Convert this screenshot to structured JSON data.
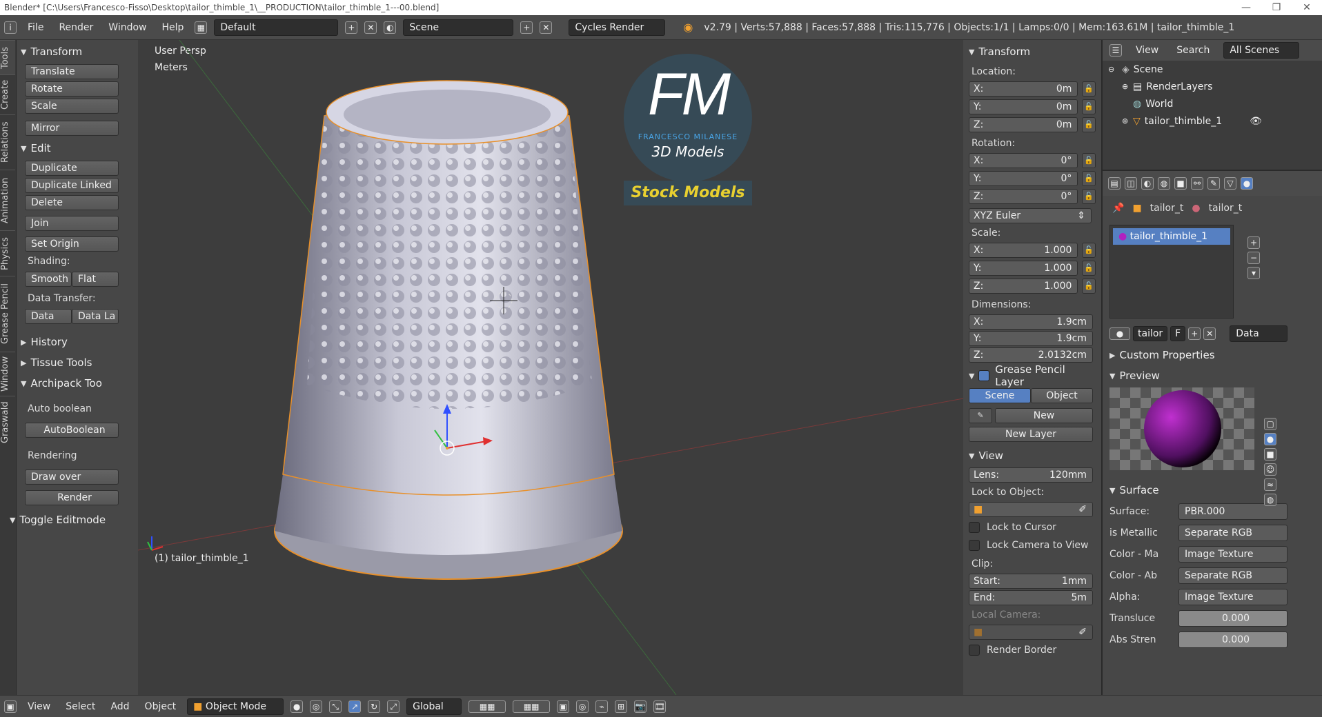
{
  "title_bar": {
    "text": "Blender* [C:\\Users\\Francesco-Fisso\\Desktop\\tailor_thimble_1\\__PRODUCTION\\tailor_thimble_1---00.blend]",
    "minimize": "—",
    "maximize": "❐",
    "close": "✕"
  },
  "info_bar": {
    "menus": [
      "File",
      "Render",
      "Window",
      "Help"
    ],
    "layout": "Default",
    "scene": "Scene",
    "engine": "Cycles Render",
    "stats": "v2.79 | Verts:57,888 | Faces:57,888 | Tris:115,776 | Objects:1/1 | Lamps:0/0 | Mem:163.61M | tailor_thimble_1"
  },
  "left_tabs": [
    "Tools",
    "Create",
    "Relations",
    "Animation",
    "Physics",
    "Grease Pencil",
    "Window",
    "Graswald"
  ],
  "tool_shelf": {
    "transform": {
      "title": "Transform",
      "buttons": [
        "Translate",
        "Rotate",
        "Scale",
        "Mirror"
      ]
    },
    "edit": {
      "title": "Edit",
      "buttons": [
        "Duplicate",
        "Duplicate Linked",
        "Delete",
        "Join"
      ],
      "set_origin": "Set Origin",
      "shading_label": "Shading:",
      "smooth": "Smooth",
      "flat": "Flat",
      "data_transfer_label": "Data Transfer:",
      "data": "Data",
      "data_la": "Data La"
    },
    "history": "History",
    "tissue": "Tissue Tools",
    "archipack": "Archipack Too",
    "auto_boolean_label": "Auto boolean",
    "auto_boolean_btn": "AutoBoolean",
    "rendering_label": "Rendering",
    "draw_over": "Draw over",
    "render_btn": "Render",
    "toggle_editmode": "Toggle Editmode"
  },
  "viewport": {
    "view_name": "User Persp",
    "units": "Meters",
    "object_label": "(1) tailor_thimble_1",
    "logo": {
      "letters": "FM",
      "brand": "FRANCESCO MILANESE",
      "line2": "3D Models",
      "banner": "Stock Models"
    }
  },
  "n_panel": {
    "transform_title": "Transform",
    "location_label": "Location:",
    "location": [
      {
        "axis": "X:",
        "value": "0m"
      },
      {
        "axis": "Y:",
        "value": "0m"
      },
      {
        "axis": "Z:",
        "value": "0m"
      }
    ],
    "rotation_label": "Rotation:",
    "rotation": [
      {
        "axis": "X:",
        "value": "0°"
      },
      {
        "axis": "Y:",
        "value": "0°"
      },
      {
        "axis": "Z:",
        "value": "0°"
      }
    ],
    "rotation_mode": "XYZ Euler",
    "scale_label": "Scale:",
    "scale": [
      {
        "axis": "X:",
        "value": "1.000"
      },
      {
        "axis": "Y:",
        "value": "1.000"
      },
      {
        "axis": "Z:",
        "value": "1.000"
      }
    ],
    "dimensions_label": "Dimensions:",
    "dimensions": [
      {
        "axis": "X:",
        "value": "1.9cm"
      },
      {
        "axis": "Y:",
        "value": "1.9cm"
      },
      {
        "axis": "Z:",
        "value": "2.0132cm"
      }
    ],
    "grease_title": "Grease Pencil Layer",
    "gp_scene": "Scene",
    "gp_object": "Object",
    "gp_new": "New",
    "gp_new_layer": "New Layer",
    "view_title": "View",
    "lens_label": "Lens:",
    "lens_value": "120mm",
    "lock_to_object_label": "Lock to Object:",
    "lock_to_cursor": "Lock to Cursor",
    "lock_camera": "Lock Camera to View",
    "clip_label": "Clip:",
    "clip_start_label": "Start:",
    "clip_start": "1mm",
    "clip_end_label": "End:",
    "clip_end": "5m",
    "local_camera": "Local Camera:",
    "render_border": "Render Border"
  },
  "outliner": {
    "tabs": [
      "View",
      "Search",
      "All Scenes"
    ],
    "items": [
      "Scene",
      "RenderLayers",
      "World",
      "tailor_thimble_1"
    ]
  },
  "properties": {
    "breadcrumb": [
      "tailor_t",
      "tailor_t"
    ],
    "material_slot": "tailor_thimble_1",
    "material_name": "tailor",
    "material_f": "F",
    "material_link": "Data",
    "custom_props": "Custom Properties",
    "preview": "Preview",
    "surface_title": "Surface",
    "rows": [
      {
        "label": "Surface:",
        "value": "PBR.000"
      },
      {
        "label": "is Metallic",
        "value": "Separate RGB"
      },
      {
        "label": "Color - Ma",
        "value": "Image Texture"
      },
      {
        "label": "Color - Ab",
        "value": "Separate RGB"
      },
      {
        "label": "Alpha:",
        "value": "Image Texture"
      },
      {
        "label": "Transluce",
        "value": "0.000"
      },
      {
        "label": "Abs Stren",
        "value": "0.000"
      }
    ]
  },
  "bottom_bar": {
    "menus": [
      "View",
      "Select",
      "Add",
      "Object"
    ],
    "mode": "Object Mode",
    "orientation": "Global"
  },
  "colors": {
    "accent": "#5680c2",
    "selection": "#f0a030",
    "bg": "#3d3d3d"
  }
}
